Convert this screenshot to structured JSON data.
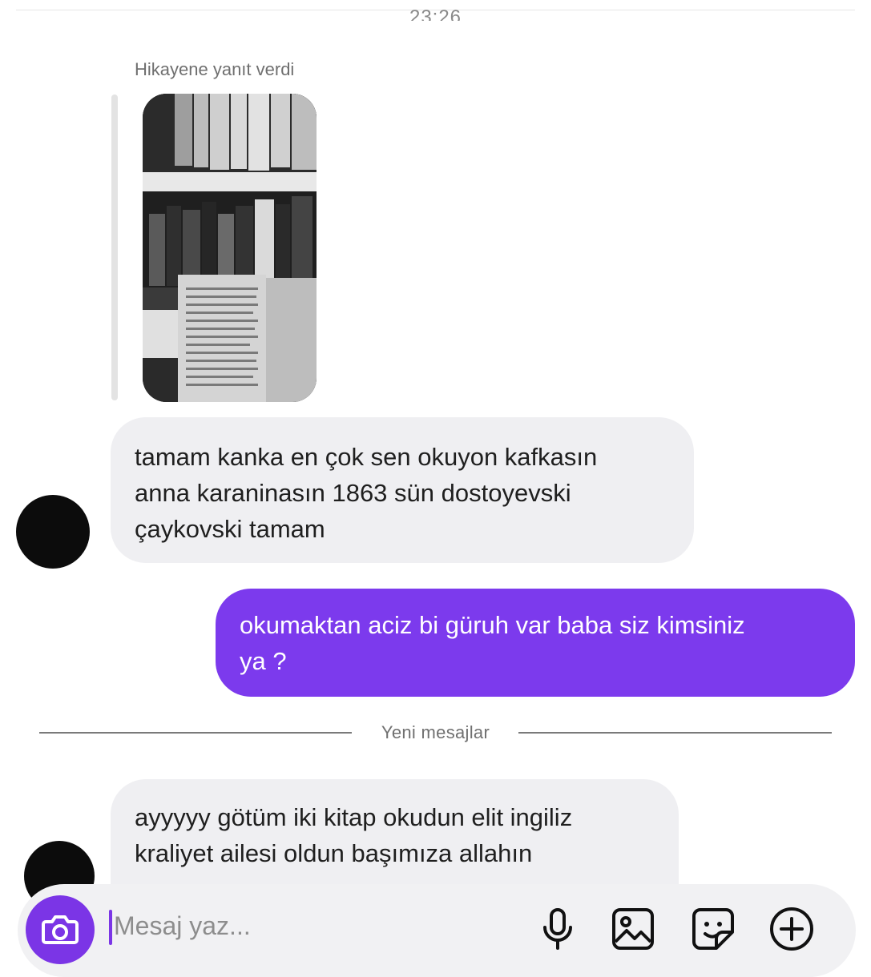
{
  "thread": {
    "timestamp": "23:26",
    "story_reply_caption": "Hikayene yanıt verdi",
    "new_messages_label": "Yeni mesajlar"
  },
  "messages": [
    {
      "direction": "incoming",
      "lines": [
        "tamam kanka en çok sen okuyon kafkasın",
        "anna karaninasın 1863 sün dostoyevski",
        "çaykovski tamam"
      ]
    },
    {
      "direction": "outgoing",
      "lines": [
        "okumaktan aciz bi güruh var baba siz kimsiniz",
        "ya ?"
      ]
    },
    {
      "direction": "incoming",
      "lines": [
        "ayyyyy götüm iki kitap okudun elit ingiliz",
        "kraliyet ailesi oldun başımıza allahın"
      ]
    }
  ],
  "composer": {
    "placeholder": "Mesaj yaz...",
    "icons": [
      "camera-icon",
      "microphone-icon",
      "gallery-icon",
      "sticker-icon",
      "plus-icon"
    ]
  },
  "colors": {
    "accent": "#7c3aed",
    "incoming_bubble": "#efeff2"
  }
}
